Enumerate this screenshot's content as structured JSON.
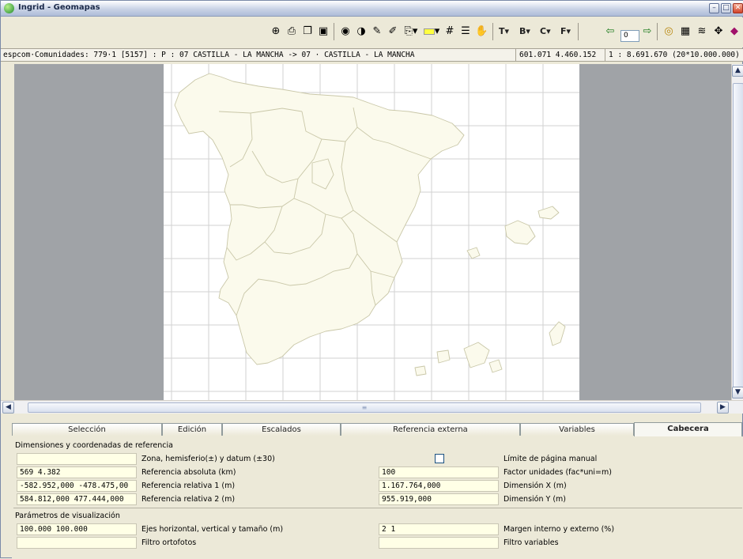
{
  "window": {
    "title": "Ingrid - Geomapas",
    "buttons": [
      "minimize",
      "maximize",
      "close"
    ]
  },
  "toolbar": {
    "icons": [
      "zoom-window-icon",
      "print-icon",
      "copy-icon",
      "save-icon",
      "layers-icon",
      "contrast-icon",
      "pencil-icon",
      "pencil-check-icon",
      "page-dropdown-icon",
      "color-dropdown-icon",
      "grid-icon",
      "list-icon",
      "hand-icon"
    ],
    "text_dropdowns": [
      {
        "label": "T",
        "arrow": "▾"
      },
      {
        "label": "B",
        "arrow": "▾"
      },
      {
        "label": "C",
        "arrow": "▾"
      },
      {
        "label": "F",
        "arrow": "▾"
      }
    ],
    "page_prev": "⇦",
    "page_value": "0",
    "page_next": "⇨",
    "right_icons": [
      "target-icon",
      "calculator-icon",
      "stack-icon",
      "move-icon",
      "eraser-icon"
    ]
  },
  "status": {
    "layer_info": "espcom·Comunidades: 779·1 [5157] : P : 07 CASTILLA - LA MANCHA -> 07 · CASTILLA - LA MANCHA",
    "coordinates": "601.071  4.460.152",
    "scale": "1 : 8.691.670 (20*10.000.000)"
  },
  "map": {
    "theme": "Spain autonomous communities",
    "region_fill": "#fbfaec",
    "region_stroke": "#c9c7a8",
    "grid_color": "#d2d2d2",
    "background": "#a0a3a7"
  },
  "tabs": [
    {
      "label": "Selección",
      "active": false
    },
    {
      "label": "Edición",
      "active": false
    },
    {
      "label": "Escalados",
      "active": false
    },
    {
      "label": "Referencia externa",
      "active": false
    },
    {
      "label": "Variables",
      "active": false
    },
    {
      "label": "Cabecera",
      "active": true
    }
  ],
  "cabecera": {
    "section1_title": "Dimensiones y coordenadas de referencia",
    "rows1": [
      {
        "value": "",
        "label": "Zona, hemisferio(±) y datum (±30)",
        "right_value": "",
        "right_is_checkbox": true,
        "right_label": "Límite de página manual"
      },
      {
        "value": "569  4.382",
        "label": "Referencia absoluta (km)",
        "right_value": "100",
        "right_label": "Factor unidades (fac*uni=m)"
      },
      {
        "value": "-582.952,000  -478.475,00",
        "label": "Referencia relativa 1 (m)",
        "right_value": "1.167.764,000",
        "right_label": "Dimensión X (m)"
      },
      {
        "value": "584.812,000  477.444,000",
        "label": "Referencia relativa 2 (m)",
        "right_value": "955.919,000",
        "right_label": "Dimensión Y (m)"
      }
    ],
    "section2_title": "Parámetros de visualización",
    "rows2": [
      {
        "value": "100.000  100.000",
        "label": "Ejes horizontal, vertical y tamaño (m)",
        "right_value": "2 1",
        "right_label": "Margen interno y externo (%)"
      },
      {
        "value": "",
        "label": "Filtro ortofotos",
        "right_value": "",
        "right_label": "Filtro variables"
      }
    ]
  },
  "scrollbars": {
    "up": "▲",
    "down": "▼",
    "left": "◀",
    "right": "▶",
    "grip": "≡"
  }
}
